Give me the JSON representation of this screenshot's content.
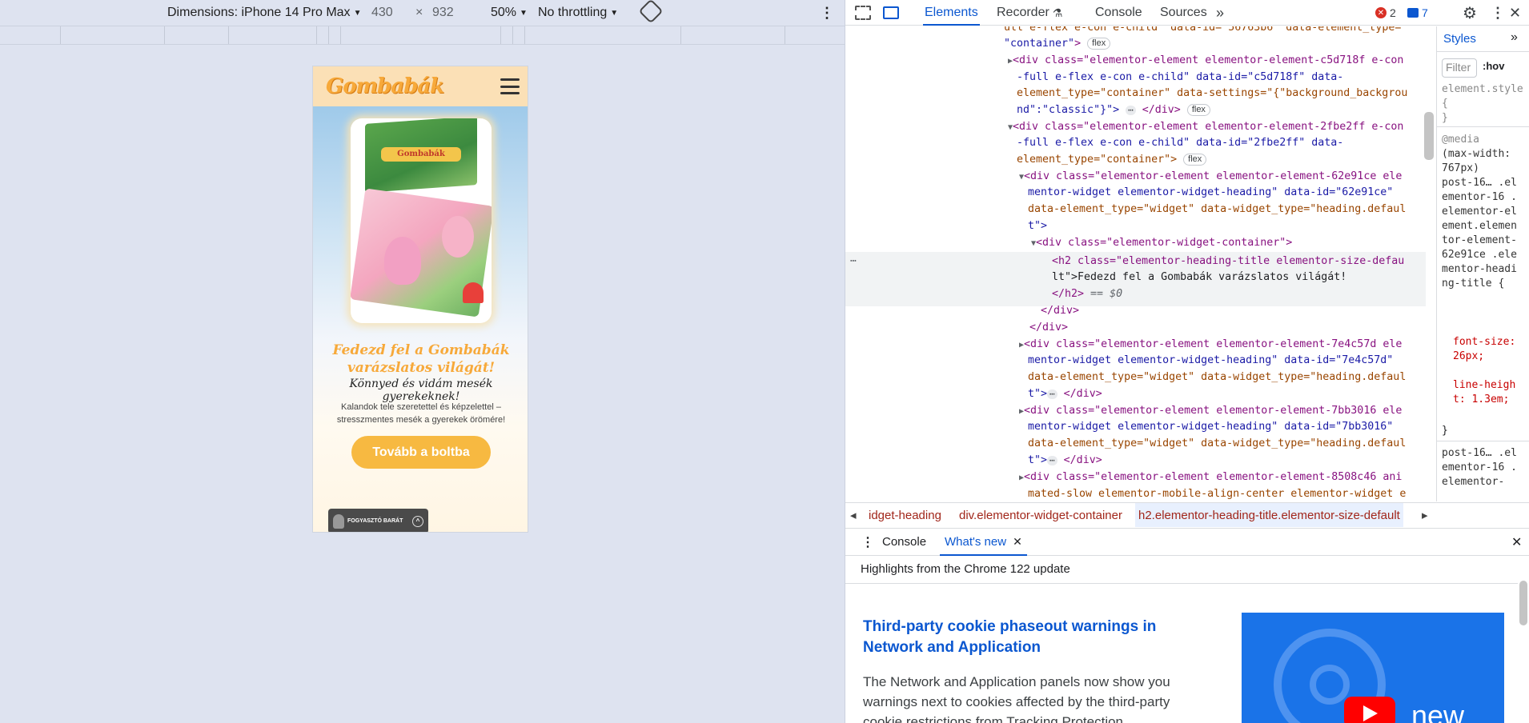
{
  "device_toolbar": {
    "dimensions_label": "Dimensions: iPhone 14 Pro Max",
    "width": "430",
    "height": "932",
    "times": "×",
    "zoom": "50%",
    "throttle": "No throttling"
  },
  "phone": {
    "logo": "Gombabák",
    "book_title": "Gombabák",
    "heading": "Fedezd fel a Gombabák varázslatos világát!",
    "subheading": "Könnyed és vidám mesék gyerekeknek!",
    "description": "Kalandok tele szeretettel és képzelettel – stresszmentes mesék a gyerekek örömére!",
    "cta": "Tovább a boltba",
    "badge": "FOGYASZTÓ BARÁT"
  },
  "devtools": {
    "tabs": [
      "Elements",
      "Recorder",
      "Console",
      "Sources"
    ],
    "errors": "2",
    "messages": "7",
    "styles_tab": "Styles",
    "filter_placeholder": "Filter",
    "hov": ":hov",
    "breadcrumbs": [
      "idget-heading",
      "div.elementor-widget-container",
      "h2.elementor-heading-title.elementor-size-default"
    ],
    "drawer_tabs": [
      "Console",
      "What's new"
    ],
    "whats_new_highlight": "Highlights from the Chrome 122 update",
    "whats_new_title": "Third-party cookie phaseout warnings in Network and Application",
    "whats_new_body": "The Network and Application panels now show you warnings next to cookies affected by the third-party cookie restrictions from Tracking Protection.",
    "whats_new_badge": "new"
  },
  "elements": {
    "l0a": "ull e-flex e-con e-child\" data-id=\"56763b6\" data-element_type=",
    "l0b": "\"container\"",
    "l1a": "<div class=\"elementor-element elementor-element-c5d718f e-con",
    "l1b": "-full e-flex e-con e-child\" data-id=\"c5d718f\" data-",
    "l1c": "element_type=\"container\" data-settings=\"{\"background_backgrou",
    "l1d": "nd\":\"classic\"}\">",
    "l2a": "<div class=\"elementor-element elementor-element-2fbe2ff e-con",
    "l2b": "-full e-flex e-con e-child\" data-id=\"2fbe2ff\" data-",
    "l2c": "element_type=\"container\">",
    "l3a": "<div class=\"elementor-element elementor-element-62e91ce ele",
    "l3b": "mentor-widget elementor-widget-heading\" data-id=\"62e91ce\"",
    "l3c": "data-element_type=\"widget\" data-widget_type=\"heading.defaul",
    "l3d": "t\">",
    "l4": "<div class=\"elementor-widget-container\">",
    "l5a": "<h2 class=\"elementor-heading-title elementor-size-defau",
    "l5b": "lt\">Fedezd fel a Gombabák varázslatos világát!",
    "l5c": "</h2>",
    "l5d": "== $0",
    "l6": "</div>",
    "l7": "</div>",
    "l8a": "<div class=\"elementor-element elementor-element-7e4c57d ele",
    "l8b": "mentor-widget elementor-widget-heading\" data-id=\"7e4c57d\"",
    "l8c": "data-element_type=\"widget\" data-widget_type=\"heading.defaul",
    "l8d": "t\">",
    "l9a": "<div class=\"elementor-element elementor-element-7bb3016 ele",
    "l9b": "mentor-widget elementor-widget-heading\" data-id=\"7bb3016\"",
    "l9c": "data-element_type=\"widget\" data-widget_type=\"heading.defaul",
    "l9d": "t\">",
    "l10a": "<div class=\"elementor-element elementor-element-8508c46 ani",
    "l10b": "mated-slow elementor-mobile-align-center elementor-widget e",
    "end_div": "</div>",
    "flex": "flex",
    "dots": "⋯"
  },
  "styles": {
    "element_style": "element.style {",
    "close_brace": "}",
    "media": "@media",
    "media_cond": "(max-width: 767px)",
    "selector": "post-16… .elementor-16 .elementor-element.elementor-element-62e91ce .elementor-heading-title {",
    "prop1": "font-size: 26px;",
    "prop2": "line-height: 1.3em;",
    "selector2": "post-16… .elementor-16 .elementor-"
  }
}
